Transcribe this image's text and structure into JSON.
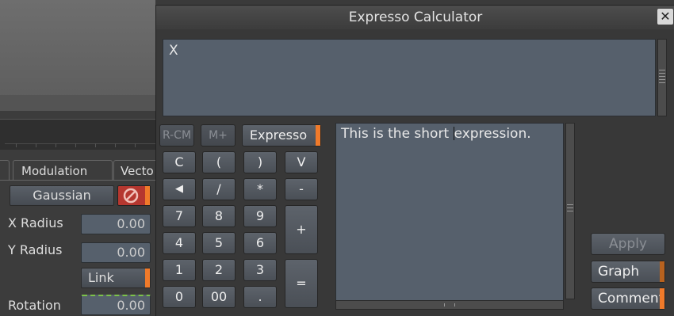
{
  "window": {
    "title": "Expresso Calculator",
    "close_glyph": "✕"
  },
  "display": {
    "value": "X"
  },
  "memory_buttons": [
    {
      "label": "R-CM",
      "enabled": false
    },
    {
      "label": "M+",
      "enabled": false
    },
    {
      "label": "Expresso",
      "enabled": true
    }
  ],
  "keypad": {
    "row1": [
      "C",
      "(",
      ")",
      "V"
    ],
    "row2": [
      "◀",
      "/",
      "*",
      "-"
    ],
    "row3": [
      "7",
      "8",
      "9"
    ],
    "row4": [
      "4",
      "5",
      "6"
    ],
    "row5": [
      "1",
      "2",
      "3"
    ],
    "row6": [
      "0",
      "00",
      "."
    ],
    "plus": "+",
    "equals": "="
  },
  "editor": {
    "text_before": "This is the short ",
    "text_after": "expression."
  },
  "actions": {
    "apply": "Apply",
    "graph": "Graph",
    "comment": "Comment"
  },
  "background_panel": {
    "tabs": [
      "Modulation",
      "Vecto"
    ],
    "filter_button": "Gaussian",
    "fields": [
      {
        "label": "X Radius",
        "value": "0.00"
      },
      {
        "label": "Y Radius",
        "value": "0.00"
      },
      {
        "label": "Rotation",
        "value": "0.00"
      }
    ],
    "link_button": "Link"
  },
  "colors": {
    "accent": "#f07a2a",
    "field_bg": "#56606c",
    "panel_bg": "#383838"
  }
}
